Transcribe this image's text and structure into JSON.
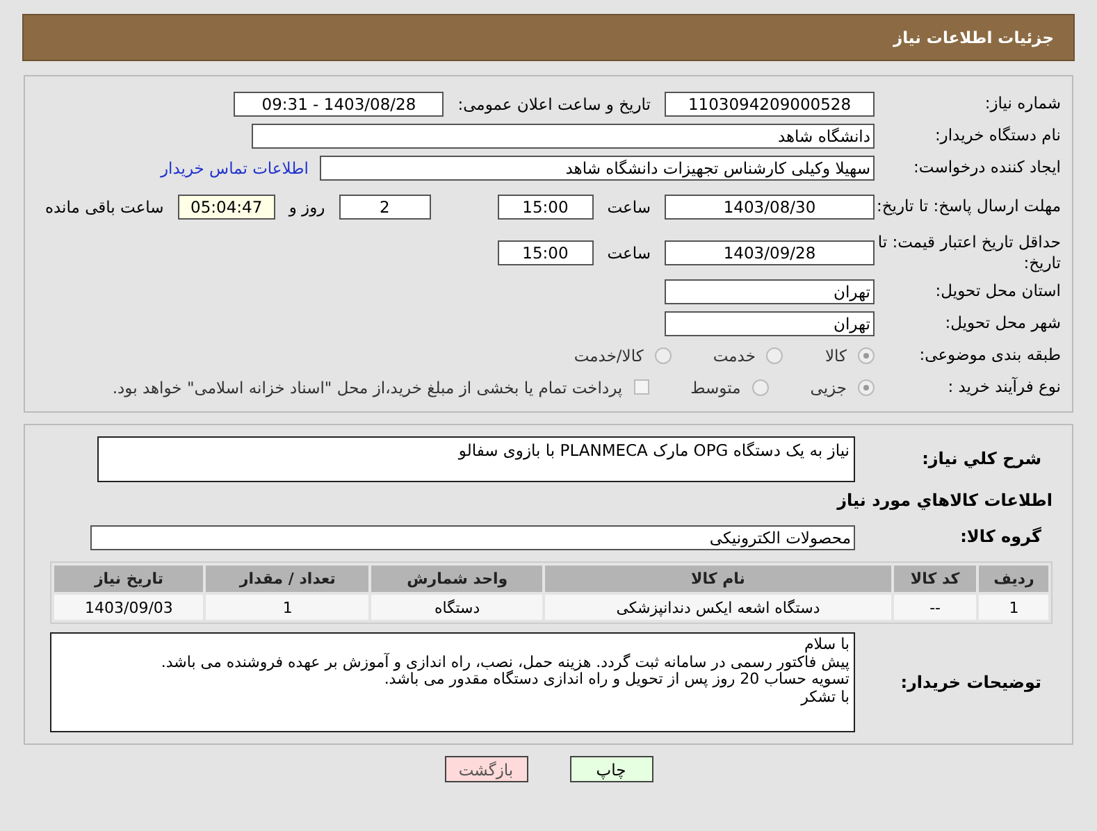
{
  "header": {
    "title": "جزئیات اطلاعات نیاز"
  },
  "details": {
    "need_number": {
      "label": "شماره نیاز:",
      "value": "1103094209000528"
    },
    "announce": {
      "label": "تاریخ و ساعت اعلان عمومی:",
      "value": "1403/08/28 - 09:31"
    },
    "buyer": {
      "label": "نام دستگاه خریدار:",
      "value": "دانشگاه شاهد"
    },
    "creator": {
      "label": "ایجاد کننده درخواست:",
      "value": "سهیلا وکیلی کارشناس تجهیزات دانشگاه شاهد",
      "link": "اطلاعات تماس خریدار"
    },
    "deadline": {
      "label": "مهلت ارسال پاسخ: تا تاریخ:",
      "date": "1403/08/30",
      "time_label": "ساعت",
      "time": "15:00",
      "days": "2",
      "days_label": "روز و",
      "remaining": "05:04:47",
      "remaining_label": "ساعت باقی مانده"
    },
    "validity": {
      "label": "حداقل تاریخ اعتبار قیمت: تا تاریخ:",
      "date": "1403/09/28",
      "time_label": "ساعت",
      "time": "15:00"
    },
    "province": {
      "label": "استان محل تحویل:",
      "value": "تهران"
    },
    "city": {
      "label": "شهر محل تحویل:",
      "value": "تهران"
    },
    "category": {
      "label": "طبقه بندی موضوعی:",
      "options": [
        {
          "label": "کالا",
          "selected": true
        },
        {
          "label": "خدمت",
          "selected": false
        },
        {
          "label": "کالا/خدمت",
          "selected": false
        }
      ]
    },
    "process": {
      "label": "نوع فرآیند خرید :",
      "options": [
        {
          "label": "جزیی",
          "selected": true
        },
        {
          "label": "متوسط",
          "selected": false
        }
      ],
      "treasury": {
        "label": "پرداخت تمام یا بخشی از مبلغ خرید،از محل \"اسناد خزانه اسلامی\" خواهد بود.",
        "checked": false
      }
    }
  },
  "description": {
    "label": "شرح کلي نیاز:",
    "value": "نیاز به یک دستگاه OPG مارک PLANMECA با بازوی سفالو"
  },
  "goods": {
    "heading": "اطلاعات کالاهاي مورد نیاز",
    "group_label": "گروه کالا:",
    "group": "محصولات الکترونیکی",
    "table": {
      "columns": [
        "ردیف",
        "کد کالا",
        "نام کالا",
        "واحد شمارش",
        "تعداد / مقدار",
        "تاریخ نیاز"
      ],
      "rows": [
        [
          "1",
          "--",
          "دستگاه اشعه ایکس دندانپزشکی",
          "دستگاه",
          "1",
          "1403/09/03"
        ]
      ]
    }
  },
  "notes": {
    "label": "توضیحات خریدار:",
    "lines": [
      "با سلام",
      "پیش فاکتور رسمی در سامانه ثبت گردد. هزینه حمل، نصب، راه اندازی و آموزش بر عهده فروشنده می باشد.",
      "تسویه حساب 20 روز پس از تحویل و راه اندازی دستگاه مقدور می باشد.",
      "با تشکر"
    ]
  },
  "buttons": [
    {
      "label": "چاپ",
      "kind": "print"
    },
    {
      "label": "بازگشت",
      "kind": "back"
    }
  ]
}
